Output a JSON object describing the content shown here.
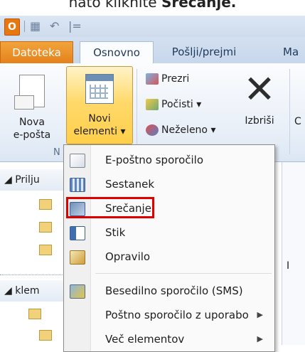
{
  "instruction": {
    "prefix": "nato kliknite ",
    "bold": "Srečanje."
  },
  "quick_access": {
    "logo_letter": "O",
    "separator_char": "|="
  },
  "tabs": {
    "file": "Datoteka",
    "home": "Osnovno",
    "send_receive": "Pošlji/prejmi",
    "more": "Ma"
  },
  "ribbon": {
    "new_email": [
      "Nova",
      "e-pošta"
    ],
    "new_items": [
      "Novi",
      "elementi ▾"
    ],
    "ignore": "Prezri",
    "clean_up": "Počisti ▾",
    "junk": "Neželeno ▾",
    "delete": "Izbriši",
    "group_label_fragment": "N",
    "right_cut_letter": "C"
  },
  "navigation": {
    "inbox_header": "◢ Prilju",
    "account_header": "◢ klem",
    "right_strip_letter": "I"
  },
  "menu": {
    "items": [
      {
        "label": "E-poštno sporočilo",
        "icon": "email-icon"
      },
      {
        "label": "Sestanek",
        "icon": "appointment-icon"
      },
      {
        "label": "Srečanje",
        "icon": "meeting-icon"
      },
      {
        "label": "Stik",
        "icon": "contact-icon"
      },
      {
        "label": "Opravilo",
        "icon": "task-icon"
      },
      {
        "label": "Besedilno sporočilo (SMS)",
        "icon": "sms-icon"
      },
      {
        "label": "Poštno sporočilo z uporabo",
        "icon": "",
        "submenu": true
      },
      {
        "label": "Več elementov",
        "icon": "",
        "submenu": true
      }
    ],
    "highlighted": "Srečanje",
    "colors": {
      "highlight_border": "#e00000",
      "file_tab": "#e5811c",
      "new_items_active": "#ffd96b"
    }
  }
}
